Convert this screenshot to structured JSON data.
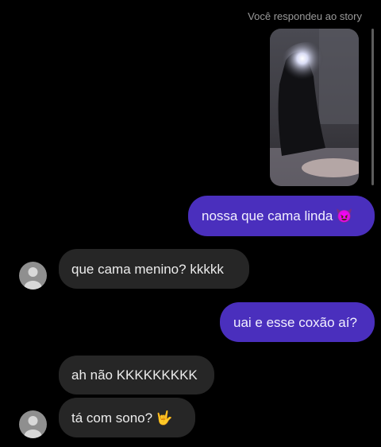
{
  "story_reply_note": "Você respondeu ao story",
  "messages": [
    {
      "text": "nossa que cama linda",
      "emoji": "😈",
      "direction": "outgoing"
    },
    {
      "text": "que cama menino? kkkkk",
      "direction": "incoming"
    },
    {
      "text": "uai e esse coxão aí?",
      "direction": "outgoing"
    },
    {
      "text": "ah não KKKKKKKKK",
      "direction": "incoming"
    },
    {
      "text": "tá com sono?",
      "emoji": "🤟",
      "direction": "incoming"
    }
  ],
  "colors": {
    "background": "#000000",
    "outgoing_bubble": "#4a2fbd",
    "incoming_bubble": "#262626",
    "meta_text": "#9a9a9a"
  }
}
